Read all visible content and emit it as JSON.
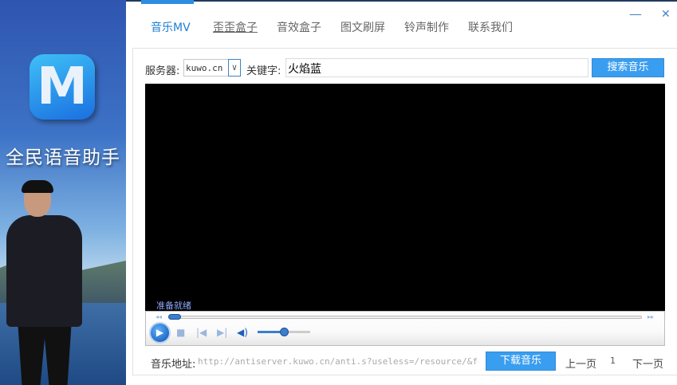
{
  "sidebar": {
    "brand": "全民语音助手",
    "logo_letter": "M"
  },
  "tabs": [
    {
      "label": "音乐MV",
      "active": true
    },
    {
      "label": "歪歪盒子"
    },
    {
      "label": "音效盒子"
    },
    {
      "label": "图文刷屏"
    },
    {
      "label": "铃声制作"
    },
    {
      "label": "联系我们"
    }
  ],
  "window": {
    "minimize": "—",
    "close": "✕"
  },
  "search": {
    "server_label": "服务器:",
    "server_value": "kuwo.cn",
    "keyword_label": "关键字:",
    "keyword_value": "火焰蓝",
    "search_button": "搜索音乐"
  },
  "player": {
    "status": "准备就绪",
    "seek_progress": 0,
    "volume_percent": 50,
    "rewind": "◂◂",
    "forward": "▸▸"
  },
  "bottom": {
    "url_label": "音乐地址:",
    "url_value": "http://antiserver.kuwo.cn/anti.s?useless=/resource/&format=",
    "download_button": "下载音乐",
    "prev_page": "上一页",
    "page": "1",
    "next_page": "下一页"
  },
  "colors": {
    "accent": "#3a9ef0",
    "active_tab": "#1e7fd0"
  }
}
